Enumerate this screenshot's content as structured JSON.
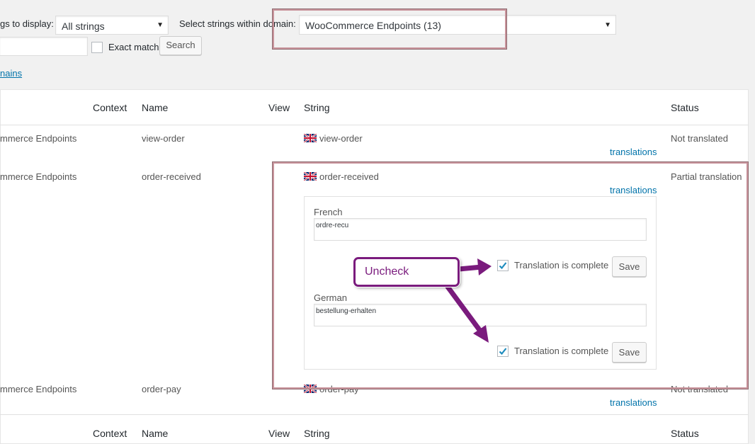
{
  "filters": {
    "display_label": "gs to display:",
    "display_value": "All strings",
    "domain_label": "Select strings within domain:",
    "domain_value": "WooCommerce Endpoints (13)",
    "exact_match_label": "Exact match",
    "search_button": "Search",
    "domains_link": "nains"
  },
  "table": {
    "columns": [
      "Context",
      "Name",
      "View",
      "String",
      "Status"
    ],
    "rows": [
      {
        "domain": "mmerce Endpoints",
        "name": "view-order",
        "string": "view-order",
        "translations_link": "translations",
        "status": "Not translated"
      },
      {
        "domain": "mmerce Endpoints",
        "name": "order-received",
        "string": "order-received",
        "translations_link": "translations",
        "status": "Partial translation"
      },
      {
        "domain": "mmerce Endpoints",
        "name": "order-pay",
        "string": "order-pay",
        "translations_link": "translations",
        "status": "Not translated"
      }
    ]
  },
  "translation_panel": {
    "french_label": "French",
    "french_value": "ordre-recu",
    "german_label": "German",
    "german_value": "bestellung-erhalten",
    "complete_label": "Translation is complete",
    "save_button": "Save"
  },
  "annotation": {
    "callout_text": "Uncheck",
    "highlight_color": "#c8939b",
    "callout_color": "#7a1b7d"
  }
}
